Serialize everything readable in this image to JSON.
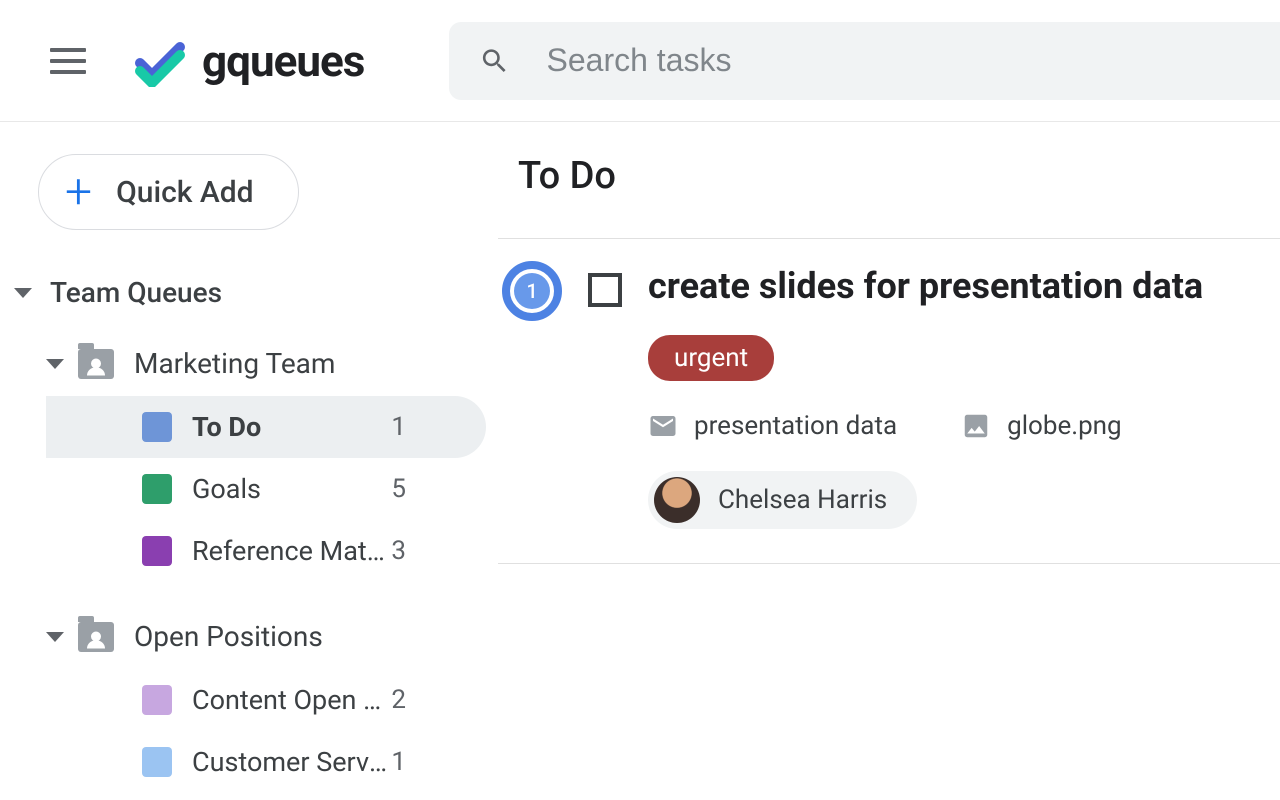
{
  "header": {
    "logo_text": "gqueues",
    "search_placeholder": "Search tasks"
  },
  "sidebar": {
    "quick_add_label": "Quick Add",
    "section_label": "Team Queues",
    "teams": [
      {
        "name": "Marketing Team",
        "queues": [
          {
            "label": "To Do",
            "count": "1",
            "color": "#6e95d7",
            "selected": true
          },
          {
            "label": "Goals",
            "count": "5",
            "color": "#2e9e6b",
            "selected": false
          },
          {
            "label": "Reference Materi...",
            "count": "3",
            "color": "#8a3fb0",
            "selected": false
          }
        ]
      },
      {
        "name": "Open Positions",
        "queues": [
          {
            "label": "Content Open Pos...",
            "count": "2",
            "color": "#c7a7e0",
            "selected": false
          },
          {
            "label": "Customer Service ...",
            "count": "1",
            "color": "#9bc4f2",
            "selected": false
          }
        ]
      }
    ]
  },
  "main": {
    "title": "To Do",
    "task": {
      "position": "1",
      "title": "create slides for presentation data",
      "tag_label": "urgent",
      "tag_color": "#a83e3b",
      "attachments": [
        {
          "kind": "mail",
          "label": "presentation data"
        },
        {
          "kind": "image",
          "label": "globe.png"
        }
      ],
      "assignee": "Chelsea Harris"
    }
  }
}
